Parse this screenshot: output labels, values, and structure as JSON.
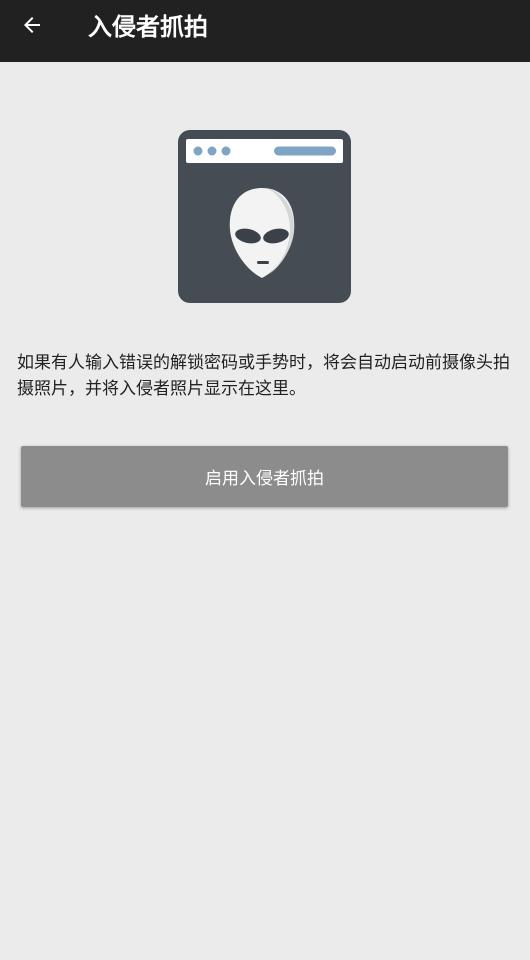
{
  "app_bar": {
    "back_icon": "arrow-back-icon",
    "title": "入侵者抓拍",
    "background": "#212121"
  },
  "illustration": {
    "icon": "alien-browser-window-icon"
  },
  "description": "如果有人输入错误的解锁密码或手势时，将会自动启动前摄像头拍摄照片，并将入侵者照片显示在这里。",
  "enable_button": {
    "label": "启用入侵者抓拍",
    "background": "#8c8c8c"
  },
  "colors": {
    "page_background": "#ebebeb",
    "window_frame": "#454c53",
    "window_accent": "#7fa4c4"
  }
}
